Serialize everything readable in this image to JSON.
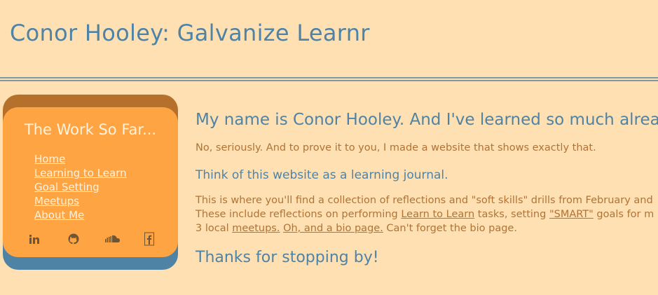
{
  "header": {
    "title": "Conor Hooley: Galvanize Learnr"
  },
  "sidebar": {
    "heading": "The Work So Far...",
    "items": [
      {
        "label": "Home"
      },
      {
        "label": "Learning to Learn"
      },
      {
        "label": "Goal Setting"
      },
      {
        "label": "Meetups"
      },
      {
        "label": "About Me"
      }
    ],
    "social": [
      {
        "icon": "linkedin-icon"
      },
      {
        "icon": "github-icon"
      },
      {
        "icon": "soundcloud-icon"
      },
      {
        "icon": "facebook-icon"
      }
    ]
  },
  "main": {
    "heading": "My name is Conor Hooley. And I've learned so much already!",
    "intro": "No, seriously. And to prove it to you, I made a website that shows exactly that.",
    "journal": "Think of this website as a learning journal.",
    "line1": "This is where you'll find a collection of reflections and \"soft skills\" drills from February and",
    "line2_pre": "These include reflections on performing ",
    "line2_link1": "Learn to Learn",
    "line2_mid": " tasks, setting ",
    "line2_link2": "\"SMART\"",
    "line2_post": " goals for m",
    "line3_pre": "3 local ",
    "line3_link1": "meetups.",
    "line3_link2": "Oh, and a bio page.",
    "line3_post": " Can't forget the bio page.",
    "thanks": "Thanks for stopping by!"
  },
  "colors": {
    "background": "#ffe0b2",
    "title_blue": "#4f83a6",
    "sidebar_orange": "#ffa443",
    "sidebar_top": "#b5712c",
    "text_brown": "#b07335",
    "sidebar_text": "#fff2dc"
  }
}
